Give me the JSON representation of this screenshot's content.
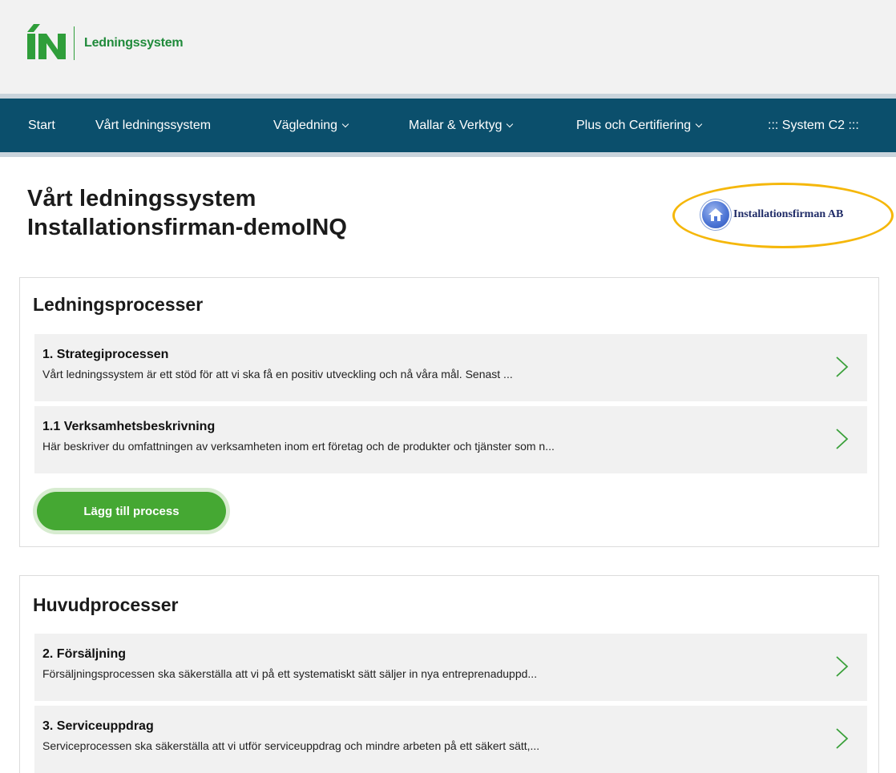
{
  "header": {
    "logo_text": "Ledningssystem",
    "brand_color": "#1f8a3a"
  },
  "nav": {
    "bg_color": "#0b4f6c",
    "items": [
      {
        "label": "Start",
        "has_dropdown": false
      },
      {
        "label": "Vårt ledningssystem",
        "has_dropdown": false
      },
      {
        "label": "Vägledning",
        "has_dropdown": true
      },
      {
        "label": "Mallar & Verktyg",
        "has_dropdown": true
      },
      {
        "label": "Plus och Certifiering",
        "has_dropdown": true
      },
      {
        "label": "::: System C2 :::",
        "has_dropdown": false
      }
    ]
  },
  "page": {
    "title_line1": "Vårt ledningssystem",
    "title_line2": "Installationsfirman-demoINQ",
    "company_name": "Installationsfirman AB",
    "company_icon": "home-icon",
    "highlight_color": "#f5b70a"
  },
  "sections": [
    {
      "title": "Ledningsprocesser",
      "processes": [
        {
          "title": "1. Strategiprocessen",
          "description": "Vårt ledningssystem är ett stöd för att vi ska få en positiv utveckling och nå våra mål. Senast ..."
        },
        {
          "title": "1.1 Verksamhetsbeskrivning",
          "description": "Här beskriver du omfattningen av verksamheten inom ert företag och de produkter och tjänster som n..."
        }
      ],
      "add_button_label": "Lägg till process"
    },
    {
      "title": "Huvudprocesser",
      "processes": [
        {
          "title": "2. Försäljning",
          "description": "Försäljningsprocessen ska säkerställa att vi på ett systematiskt sätt säljer in nya entreprenaduppd..."
        },
        {
          "title": "3. Serviceuppdrag",
          "description": "Serviceprocessen ska säkerställa att vi utför serviceuppdrag och mindre arbeten på ett säkert sätt,..."
        }
      ]
    }
  ],
  "colors": {
    "accent_green": "#45a833",
    "row_bg": "#f1f1f1",
    "chevron_green": "#3aa03a"
  }
}
